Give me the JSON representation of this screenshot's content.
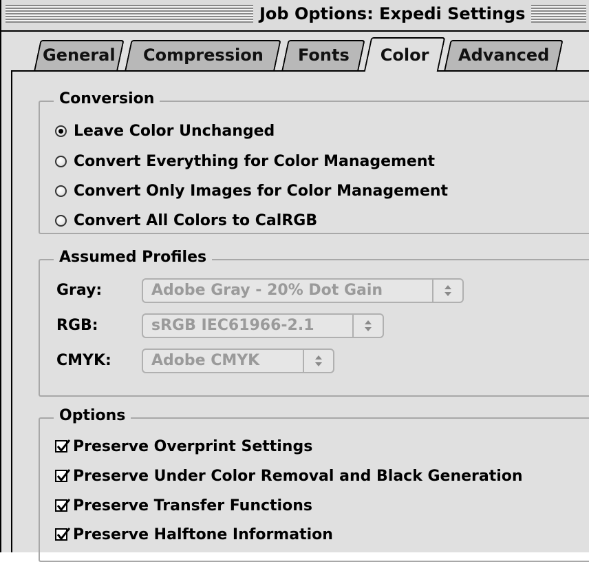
{
  "window": {
    "title": "Job Options: Expedi Settings"
  },
  "tabs": [
    {
      "label": "General"
    },
    {
      "label": "Compression"
    },
    {
      "label": "Fonts"
    },
    {
      "label": "Color"
    },
    {
      "label": "Advanced"
    }
  ],
  "active_tab": "Color",
  "conversion": {
    "title": "Conversion",
    "options": [
      {
        "label": "Leave Color Unchanged",
        "selected": true
      },
      {
        "label": "Convert Everything for Color Management",
        "selected": false
      },
      {
        "label": "Convert Only Images for Color Management",
        "selected": false
      },
      {
        "label": "Convert All Colors to CalRGB",
        "selected": false
      }
    ]
  },
  "profiles": {
    "title": "Assumed Profiles",
    "gray": {
      "label": "Gray:",
      "value": "Adobe Gray - 20% Dot Gain"
    },
    "rgb": {
      "label": "RGB:",
      "value": "sRGB IEC61966-2.1"
    },
    "cmyk": {
      "label": "CMYK:",
      "value": "Adobe CMYK"
    },
    "disabled": true
  },
  "options": {
    "title": "Options",
    "items": [
      {
        "label": "Preserve Overprint Settings",
        "checked": true
      },
      {
        "label": "Preserve Under Color Removal and Black Generation",
        "checked": true
      },
      {
        "label": "Preserve Transfer Functions",
        "checked": true
      },
      {
        "label": "Preserve Halftone Information",
        "checked": true
      }
    ]
  },
  "icons": {
    "popup_arrows": "up-down-arrows-icon",
    "checkmark": "checkmark-icon",
    "radio": "radio-button-icon"
  }
}
